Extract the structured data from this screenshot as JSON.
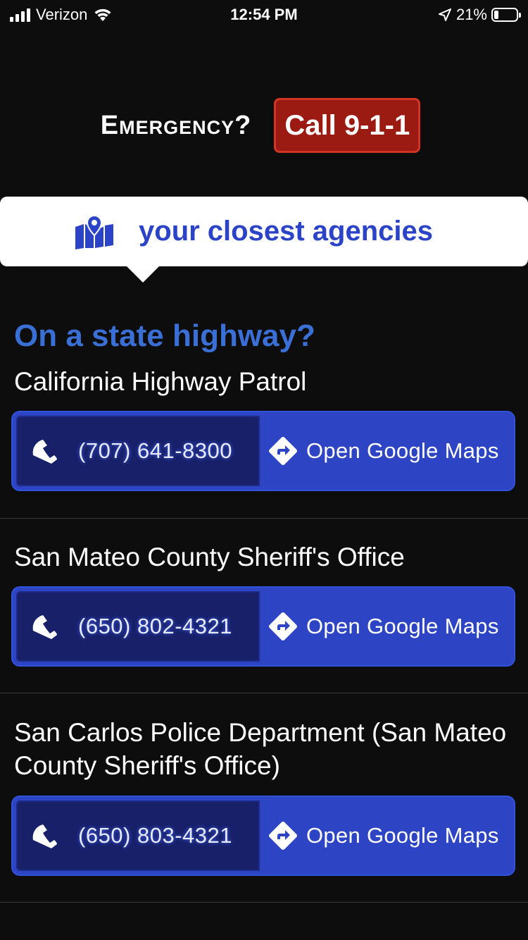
{
  "status_bar": {
    "carrier": "Verizon",
    "time": "12:54 PM",
    "battery_percent": "21%",
    "battery_level": 0.21,
    "icons": [
      "signal-icon",
      "wifi-icon",
      "location-arrow-icon",
      "battery-icon"
    ]
  },
  "emergency": {
    "label": "Emergency?",
    "call_button": "Call 9-1-1",
    "call_color": "#9b1b12"
  },
  "closest": {
    "icon": "map-marker-icon",
    "title": "your closest agencies"
  },
  "agencies": [
    {
      "heading": "On a state highway?",
      "name": "California Highway Patrol",
      "phone": "(707) 641-8300",
      "maps_label": "Open Google Maps"
    },
    {
      "heading": "",
      "name": "San Mateo County Sheriff's Office",
      "phone": "(650) 802-4321",
      "maps_label": "Open Google Maps"
    },
    {
      "heading": "",
      "name": "San Carlos Police Department (San Mateo County Sheriff's Office)",
      "phone": "(650) 803-4321",
      "maps_label": "Open Google Maps"
    }
  ],
  "colors": {
    "accent_blue": "#2d44c4",
    "heading_blue": "#3a6fd6",
    "background": "#0d0d0d"
  }
}
